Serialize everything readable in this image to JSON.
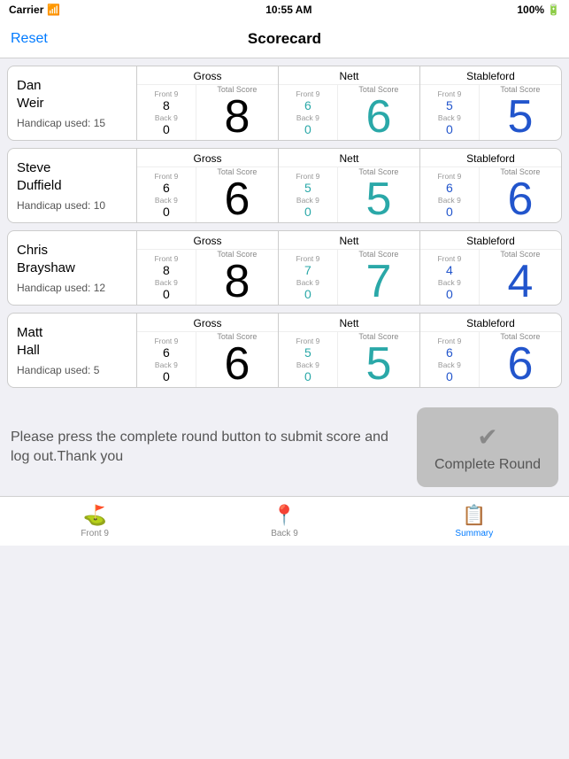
{
  "statusBar": {
    "carrier": "Carrier",
    "time": "10:55 AM",
    "battery": "100%"
  },
  "navBar": {
    "resetLabel": "Reset",
    "title": "Scorecard"
  },
  "sections": {
    "gross": "Gross",
    "nett": "Nett",
    "stableford": "Stableford",
    "frontNine": "Front 9",
    "backNine": "Back 9",
    "totalScore": "Total Score"
  },
  "players": [
    {
      "name": "Dan\nWeir",
      "handicap": "Handicap used: 15",
      "gross": {
        "front": "8",
        "back": "0",
        "total": "8"
      },
      "nett": {
        "front": "6",
        "back": "0",
        "total": "6"
      },
      "stableford": {
        "front": "5",
        "back": "0",
        "total": "5"
      }
    },
    {
      "name": "Steve\nDuffield",
      "handicap": "Handicap used: 10",
      "gross": {
        "front": "6",
        "back": "0",
        "total": "6"
      },
      "nett": {
        "front": "5",
        "back": "0",
        "total": "5"
      },
      "stableford": {
        "front": "6",
        "back": "0",
        "total": "6"
      }
    },
    {
      "name": "Chris\nBrayshaw",
      "handicap": "Handicap used: 12",
      "gross": {
        "front": "8",
        "back": "0",
        "total": "8"
      },
      "nett": {
        "front": "7",
        "back": "0",
        "total": "7"
      },
      "stableford": {
        "front": "4",
        "back": "0",
        "total": "4"
      }
    },
    {
      "name": "Matt\nHall",
      "handicap": "Handicap used: 5",
      "gross": {
        "front": "6",
        "back": "0",
        "total": "6"
      },
      "nett": {
        "front": "5",
        "back": "0",
        "total": "5"
      },
      "stableford": {
        "front": "6",
        "back": "0",
        "total": "6"
      }
    }
  ],
  "bottomText": "Please press the complete round button to submit score and log out.Thank you",
  "completeRoundLabel": "Complete Round",
  "tabs": [
    {
      "label": "Front 9",
      "icon": "flag",
      "active": false
    },
    {
      "label": "Back 9",
      "icon": "pin",
      "active": false
    },
    {
      "label": "Summary",
      "icon": "doc",
      "active": true
    }
  ]
}
